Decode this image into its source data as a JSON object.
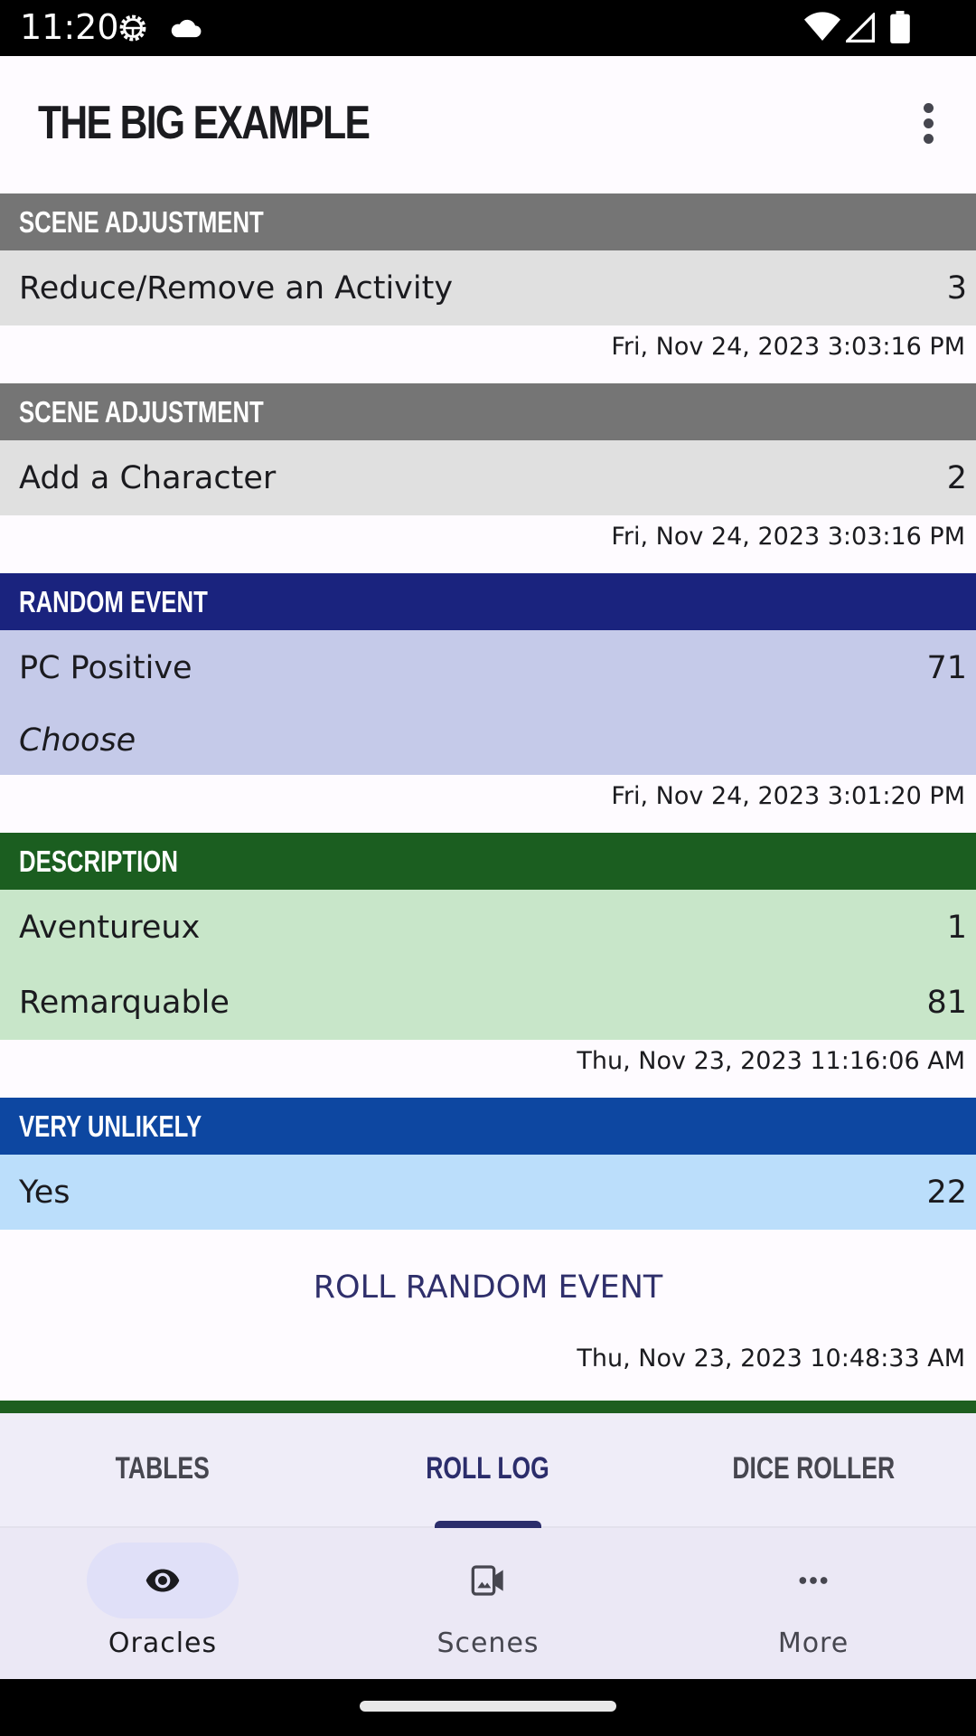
{
  "status_bar": {
    "time": "11:20",
    "icons": [
      "android-gear-icon",
      "cloud-icon",
      "wifi-icon",
      "signal-icon",
      "battery-icon"
    ]
  },
  "app_bar": {
    "title": "THE BIG EXAMPLE",
    "menu_icon": "more-vert-icon"
  },
  "log_entries": [
    {
      "category": "SCENE ADJUSTMENT",
      "header_color": "#757575",
      "body_color": "#e0e0e0",
      "results": [
        {
          "label": "Reduce/Remove an Activity",
          "value": "3"
        }
      ],
      "timestamp": "Fri, Nov 24, 2023 3:03:16 PM"
    },
    {
      "category": "SCENE ADJUSTMENT",
      "header_color": "#757575",
      "body_color": "#e0e0e0",
      "results": [
        {
          "label": "Add a Character",
          "value": "2"
        }
      ],
      "timestamp": "Fri, Nov 24, 2023 3:03:16 PM"
    },
    {
      "category": "RANDOM EVENT",
      "header_color": "#1a237e",
      "body_color": "#c5cae9",
      "results": [
        {
          "label": "PC Positive",
          "value": "71"
        },
        {
          "label": "Choose",
          "value": "",
          "italic": true
        }
      ],
      "timestamp": "Fri, Nov 24, 2023 3:01:20 PM"
    },
    {
      "category": "DESCRIPTION",
      "header_color": "#1b5e20",
      "body_color": "#c8e6c9",
      "results": [
        {
          "label": "Aventureux",
          "value": "1"
        },
        {
          "label": "Remarquable",
          "value": "81"
        }
      ],
      "timestamp": "Thu, Nov 23, 2023 11:16:06 AM"
    },
    {
      "category": "VERY UNLIKELY",
      "header_color": "#0d47a1",
      "body_color": "#bbdefb",
      "results": [
        {
          "label": "Yes",
          "value": "22"
        }
      ],
      "action_label": "ROLL RANDOM EVENT",
      "timestamp": "Thu, Nov 23, 2023 10:48:33 AM"
    }
  ],
  "tabs": [
    {
      "label": "TABLES",
      "active": false
    },
    {
      "label": "ROLL LOG",
      "active": true
    },
    {
      "label": "DICE ROLLER",
      "active": false
    }
  ],
  "bottom_nav": [
    {
      "label": "Oracles",
      "icon": "eye-icon",
      "active": true
    },
    {
      "label": "Scenes",
      "icon": "video-camera-icon",
      "active": false
    },
    {
      "label": "More",
      "icon": "more-horiz-icon",
      "active": false
    }
  ]
}
